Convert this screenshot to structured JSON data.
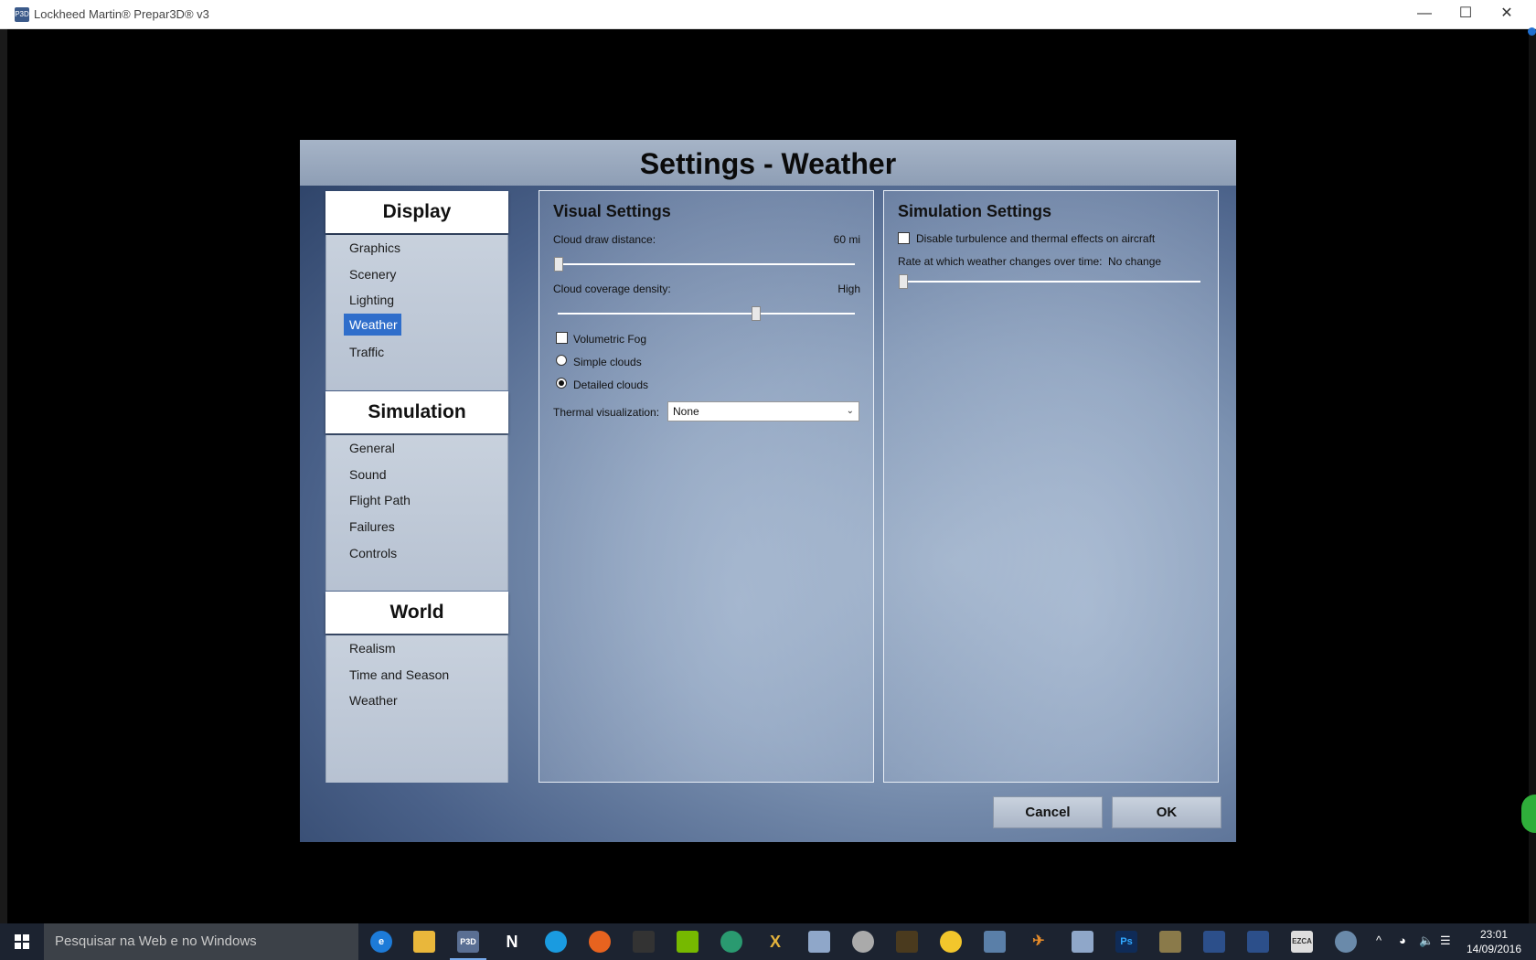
{
  "window": {
    "title": "Lockheed Martin® Prepar3D® v3",
    "icon_text": "P3D",
    "minimize_glyph": "—",
    "maximize_glyph": "☐",
    "close_glyph": "✕"
  },
  "dialog": {
    "title": "Settings - Weather",
    "categories": [
      {
        "header": "Display",
        "items": [
          "Graphics",
          "Scenery",
          "Lighting",
          "Weather",
          "Traffic"
        ]
      },
      {
        "header": "Simulation",
        "items": [
          "General",
          "Sound",
          "Flight Path",
          "Failures",
          "Controls"
        ]
      },
      {
        "header": "World",
        "items": [
          "Realism",
          "Time and Season",
          "Weather"
        ]
      }
    ],
    "selected_item": "Display > Weather",
    "visual": {
      "title": "Visual Settings",
      "cloud_draw_distance": {
        "label": "Cloud draw distance:",
        "value": "60 mi",
        "level": 0.0
      },
      "cloud_coverage_density": {
        "label": "Cloud coverage density:",
        "value": "High",
        "level": 0.67
      },
      "volumetric_fog": {
        "label": "Volumetric Fog",
        "checked": false
      },
      "simple_clouds": {
        "label": "Simple clouds",
        "selected": false
      },
      "detailed_clouds": {
        "label": "Detailed clouds",
        "selected": true
      },
      "thermal_visualization": {
        "label": "Thermal visualization:",
        "value": "None"
      }
    },
    "simulation": {
      "title": "Simulation Settings",
      "disable_turbulence": {
        "label": "Disable turbulence and thermal effects on aircraft",
        "checked": false
      },
      "weather_change_rate": {
        "label": "Rate at which weather changes over time:",
        "value": "No change",
        "level": 0.0
      }
    },
    "buttons": {
      "cancel": "Cancel",
      "ok": "OK"
    }
  },
  "taskbar": {
    "search_placeholder": "Pesquisar na Web e no Windows",
    "icons": [
      "edge-icon",
      "file-explorer-icon",
      "p3d-icon",
      "n-app-icon",
      "skype-icon",
      "firefox-icon",
      "app-icon",
      "nvidia-icon",
      "globe-app-icon",
      "x-plane-icon",
      "app-icon",
      "globe-icon",
      "app-icon",
      "weather-icon",
      "app-icon",
      "plane-icon",
      "app-icon",
      "photoshop-icon",
      "app-icon",
      "app-icon",
      "app-icon",
      "ezca-icon",
      "app-icon"
    ],
    "p3d_label": "P3D",
    "n_label": "N",
    "x_label": "X",
    "ps_label": "Ps",
    "ezca_label": "EZCA",
    "time": "23:01",
    "date": "14/09/2016"
  },
  "colors": {
    "selection": "#2f6ecb",
    "taskbar": "#1c2330",
    "search_box": "#3c4148"
  }
}
